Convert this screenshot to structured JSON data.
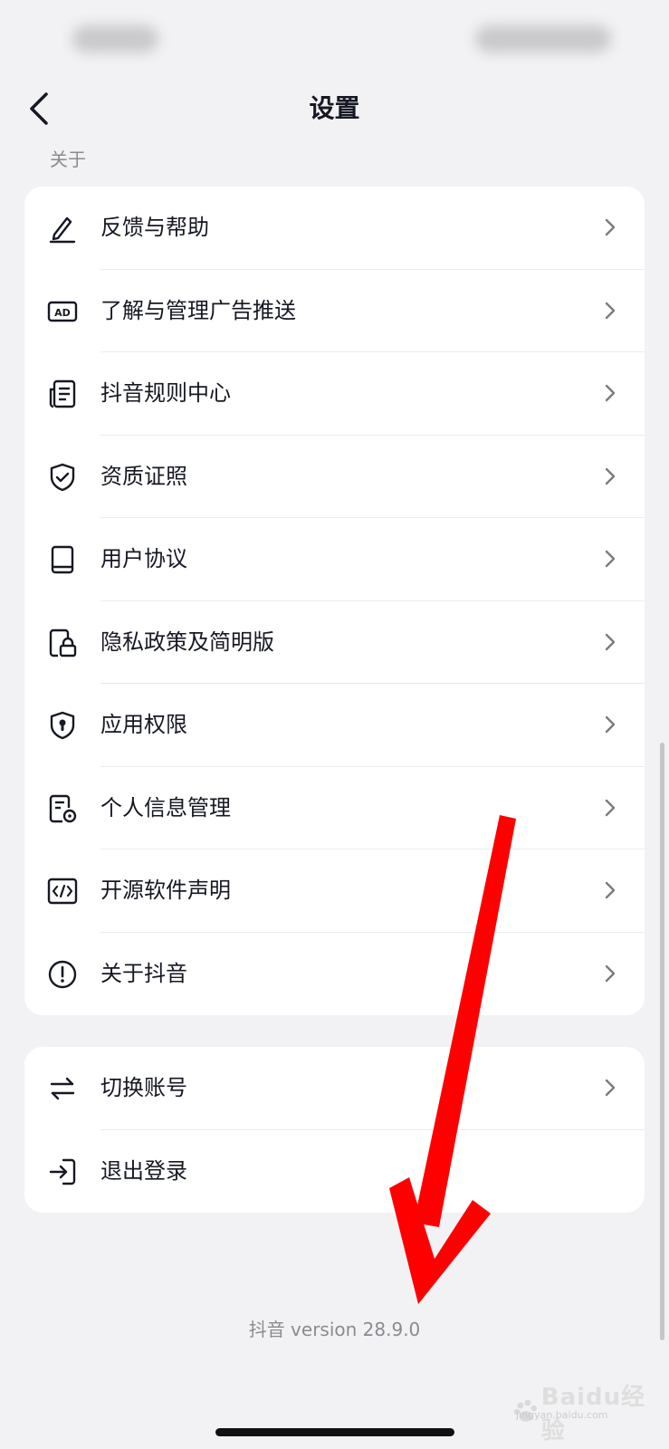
{
  "nav": {
    "title": "设置"
  },
  "about": {
    "section_label": "关于",
    "items": [
      {
        "label": "反馈与帮助",
        "icon": "edit-pen-icon"
      },
      {
        "label": "了解与管理广告推送",
        "icon": "ad-icon"
      },
      {
        "label": "抖音规则中心",
        "icon": "rules-document-icon"
      },
      {
        "label": "资质证照",
        "icon": "shield-check-icon"
      },
      {
        "label": "用户协议",
        "icon": "book-icon"
      },
      {
        "label": "隐私政策及简明版",
        "icon": "privacy-lock-icon"
      },
      {
        "label": "应用权限",
        "icon": "shield-keyhole-icon"
      },
      {
        "label": "个人信息管理",
        "icon": "personal-info-icon"
      },
      {
        "label": "开源软件声明",
        "icon": "code-icon"
      },
      {
        "label": "关于抖音",
        "icon": "info-exclamation-icon"
      }
    ]
  },
  "account": {
    "items": [
      {
        "label": "切换账号",
        "icon": "switch-arrows-icon"
      },
      {
        "label": "退出登录",
        "icon": "logout-icon"
      }
    ]
  },
  "footer": {
    "version_text": "抖音 version 28.9.0"
  },
  "watermark": {
    "text": "Baidu经验",
    "sub": "jingyan.baidu.com"
  },
  "colors": {
    "annotation_arrow": "#ff0000",
    "card_bg": "#ffffff",
    "page_bg": "#f2f2f5"
  }
}
